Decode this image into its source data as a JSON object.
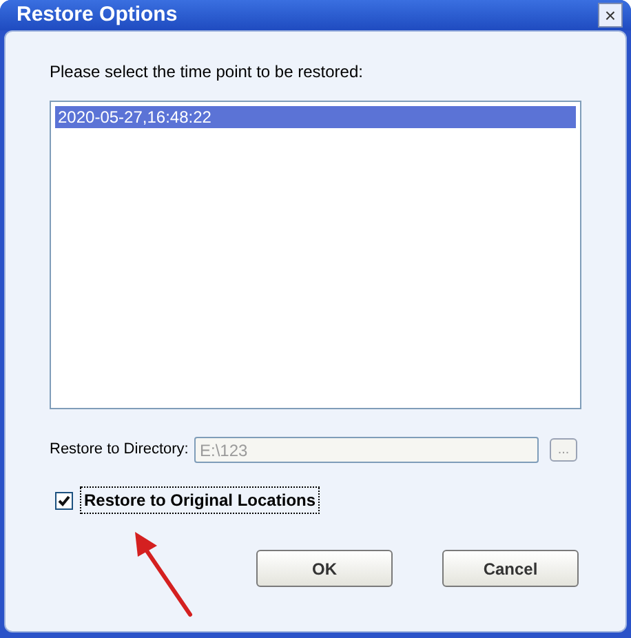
{
  "window": {
    "title": "Restore Options",
    "close": "×"
  },
  "prompt": "Please select the time point to be restored:",
  "time_points": [
    {
      "label": "2020-05-27,16:48:22",
      "selected": true
    }
  ],
  "directory": {
    "label": "Restore to Directory:",
    "value": "E:\\123",
    "disabled": true,
    "browse": "...",
    "browse_disabled": true
  },
  "original_locations": {
    "label": "Restore to Original Locations",
    "checked": true
  },
  "buttons": [
    "OK",
    "Cancel"
  ],
  "annotation": {
    "kind": "arrow"
  }
}
